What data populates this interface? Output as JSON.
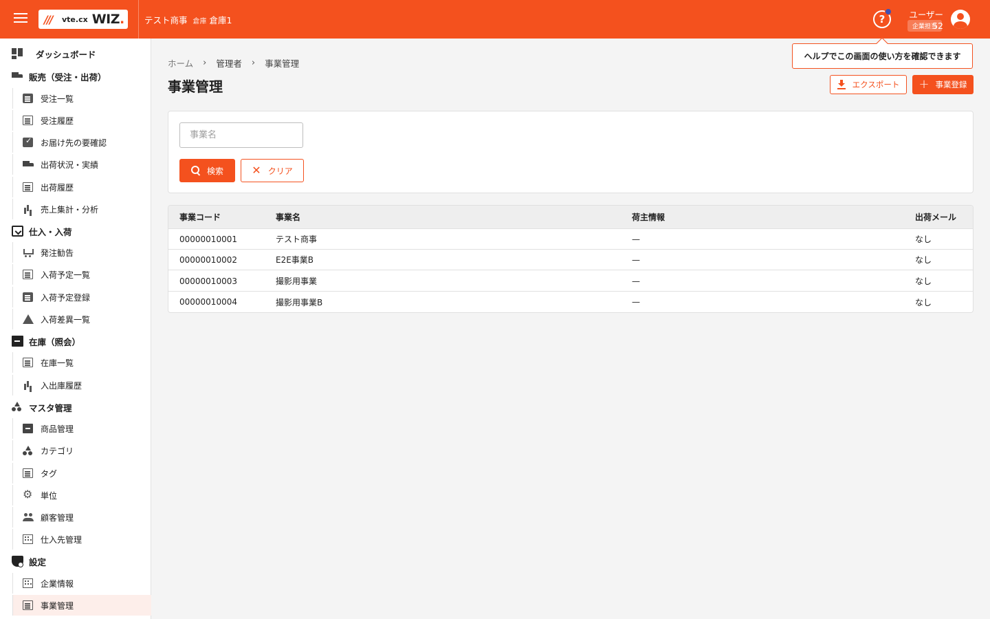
{
  "header": {
    "logo_mark": "///",
    "logo_vte": "vte.cx",
    "logo_wiz": "WIZ",
    "logo_dot": ".",
    "company": "テスト商事",
    "warehouse_label": "倉庫",
    "warehouse_name": "倉庫1",
    "help_icon": "?",
    "user_name": "ユーザー52",
    "user_role": "企業担当",
    "brand_color": "#f4511e"
  },
  "tooltip": "ヘルプでこの画面の使い方を確認できます",
  "sidebar": {
    "dashboard": "ダッシュボード",
    "sales": {
      "label": "販売（受注・出荷）",
      "items": [
        "受注一覧",
        "受注履歴",
        "お届け先の要確認",
        "出荷状況・実績",
        "出荷履歴",
        "売上集計・分析"
      ]
    },
    "purchase": {
      "label": "仕入・入荷",
      "items": [
        "発注勧告",
        "入荷予定一覧",
        "入荷予定登録",
        "入荷差異一覧"
      ]
    },
    "stock": {
      "label": "在庫（照会）",
      "items": [
        "在庫一覧",
        "入出庫履歴"
      ]
    },
    "master": {
      "label": "マスタ管理",
      "items": [
        "商品管理",
        "カテゴリ",
        "タグ",
        "単位",
        "顧客管理",
        "仕入先管理"
      ]
    },
    "settings": {
      "label": "設定",
      "items": [
        "企業情報",
        "事業管理"
      ]
    },
    "active_item": "事業管理"
  },
  "breadcrumb": [
    "ホーム",
    "管理者",
    "事業管理"
  ],
  "page": {
    "title": "事業管理",
    "export_label": "エクスポート",
    "add_label": "事業登録"
  },
  "search": {
    "placeholder": "事業名",
    "search_label": "検索",
    "clear_label": "クリア"
  },
  "table": {
    "columns": [
      "事業コード",
      "事業名",
      "荷主情報",
      "出荷メール"
    ],
    "rows": [
      [
        "00000010001",
        "テスト商事",
        "—",
        "なし"
      ],
      [
        "00000010002",
        "E2E事業B",
        "—",
        "なし"
      ],
      [
        "00000010003",
        "撮影用事業",
        "—",
        "なし"
      ],
      [
        "00000010004",
        "撮影用事業B",
        "—",
        "なし"
      ]
    ]
  }
}
